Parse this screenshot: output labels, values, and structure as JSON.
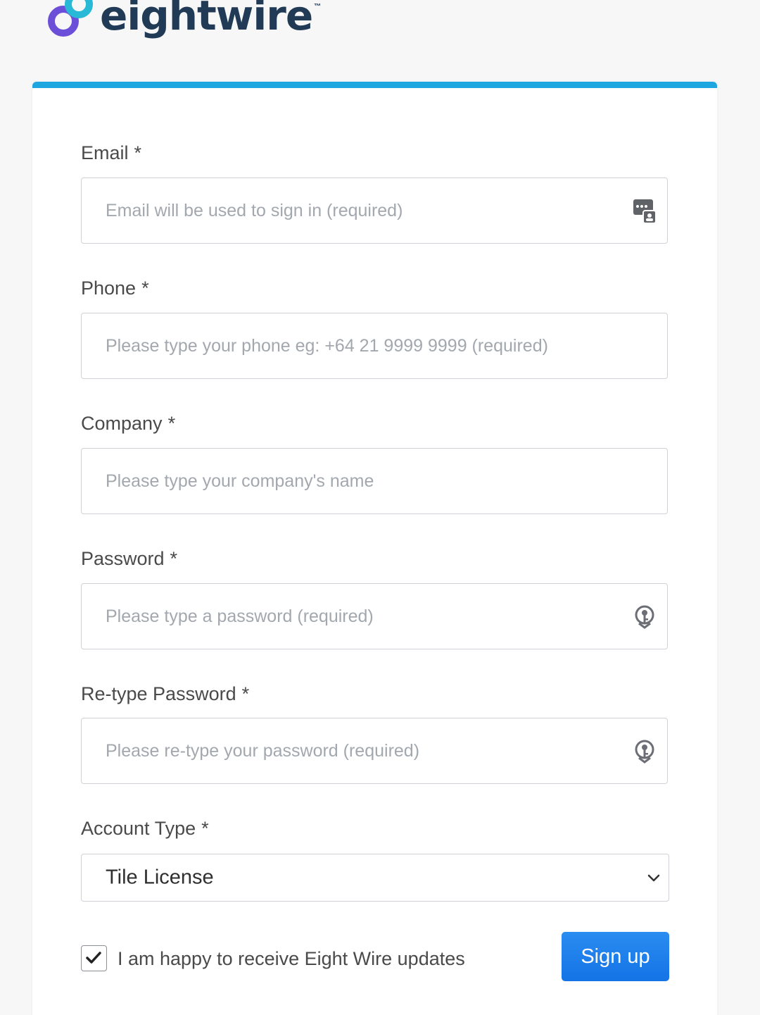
{
  "brand": {
    "name": "eightwire",
    "tm": "™",
    "accent_color": "#1ea6e0",
    "logo_colors": [
      "#6b4fd8",
      "#28b9d6"
    ]
  },
  "form": {
    "fields": [
      {
        "label": "Email",
        "required_mark": "*",
        "placeholder": "Email will be used to sign in (required)",
        "value": "",
        "icon": "autofill-contact-icon"
      },
      {
        "label": "Phone",
        "required_mark": "*",
        "placeholder": "Please type your phone eg: +64 21 9999 9999 (required)",
        "value": ""
      },
      {
        "label": "Company",
        "required_mark": "*",
        "placeholder": "Please type your company's name",
        "value": ""
      },
      {
        "label": "Password",
        "required_mark": "*",
        "placeholder": "Please type a password (required)",
        "value": "",
        "icon": "password-key-icon"
      },
      {
        "label": "Re-type Password",
        "required_mark": "*",
        "placeholder": "Please re-type your password (required)",
        "value": "",
        "icon": "password-key-icon"
      }
    ],
    "account_type": {
      "label": "Account Type",
      "required_mark": "*",
      "selected": "Tile License"
    },
    "updates_checkbox": {
      "label": "I am happy to receive Eight Wire updates",
      "checked": true
    },
    "submit_label": "Sign up",
    "submit_color": "#1a7ff0"
  }
}
